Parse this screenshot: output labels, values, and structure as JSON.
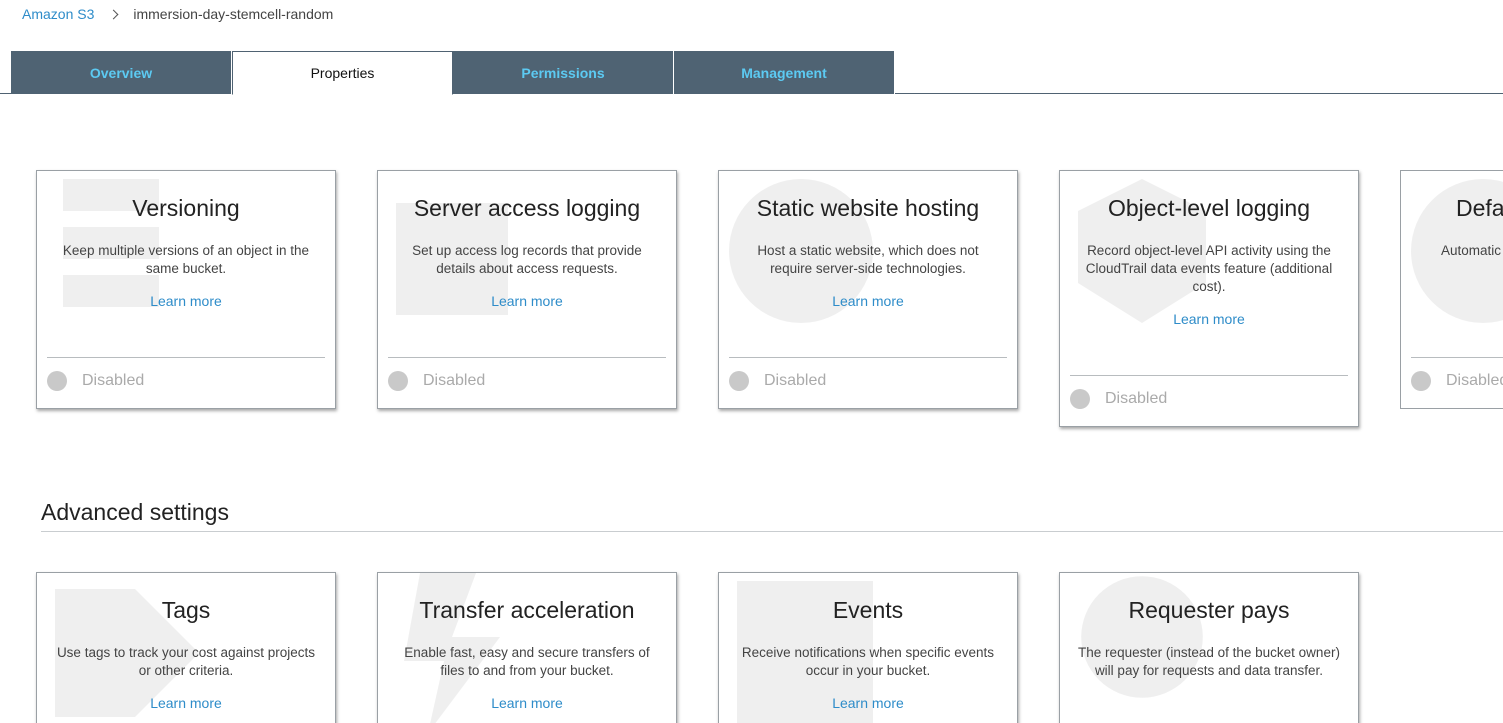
{
  "breadcrumb": {
    "root": "Amazon S3",
    "current": "immersion-day-stemcell-random"
  },
  "tabs": [
    {
      "label": "Overview",
      "active": false
    },
    {
      "label": "Properties",
      "active": true
    },
    {
      "label": "Permissions",
      "active": false
    },
    {
      "label": "Management",
      "active": false
    }
  ],
  "colors": {
    "tab_bg": "#4f6373",
    "tab_text": "#5ccaf2",
    "link": "#2e8cc9"
  },
  "cards": [
    {
      "title": "Versioning",
      "description": "Keep multiple versions of an object in the same bucket.",
      "link": "Learn more",
      "status": "Disabled",
      "icon": "versioning-icon"
    },
    {
      "title": "Server access logging",
      "description": "Set up access log records that provide details about access requests.",
      "link": "Learn more",
      "status": "Disabled",
      "icon": "logging-icon"
    },
    {
      "title": "Static website hosting",
      "description": "Host a static website, which does not require server-side technologies.",
      "link": "Learn more",
      "status": "Disabled",
      "icon": "globe-icon"
    },
    {
      "title": "Object-level logging",
      "description": "Record object-level API activity using the CloudTrail data events feature (additional cost).",
      "link": "Learn more",
      "status": "Disabled",
      "icon": "shield-icon"
    },
    {
      "title": "Defa",
      "description": "Automatic sto",
      "link": "",
      "status": "Disabled",
      "icon": "globe-icon"
    }
  ],
  "advanced": {
    "title": "Advanced settings",
    "cards": [
      {
        "title": "Tags",
        "description": "Use tags to track your cost against projects or other criteria.",
        "link": "Learn more",
        "icon": "tag-icon"
      },
      {
        "title": "Transfer acceleration",
        "description": "Enable fast, easy and secure transfers of files to and from your bucket.",
        "link": "Learn more",
        "icon": "lightning-icon"
      },
      {
        "title": "Events",
        "description": "Receive notifications when specific events occur in your bucket.",
        "link": "Learn more",
        "icon": "calendar-icon"
      },
      {
        "title": "Requester pays",
        "description": "The requester (instead of the bucket owner) will pay for requests and data transfer.",
        "link": "",
        "icon": "coin-icon"
      }
    ]
  }
}
